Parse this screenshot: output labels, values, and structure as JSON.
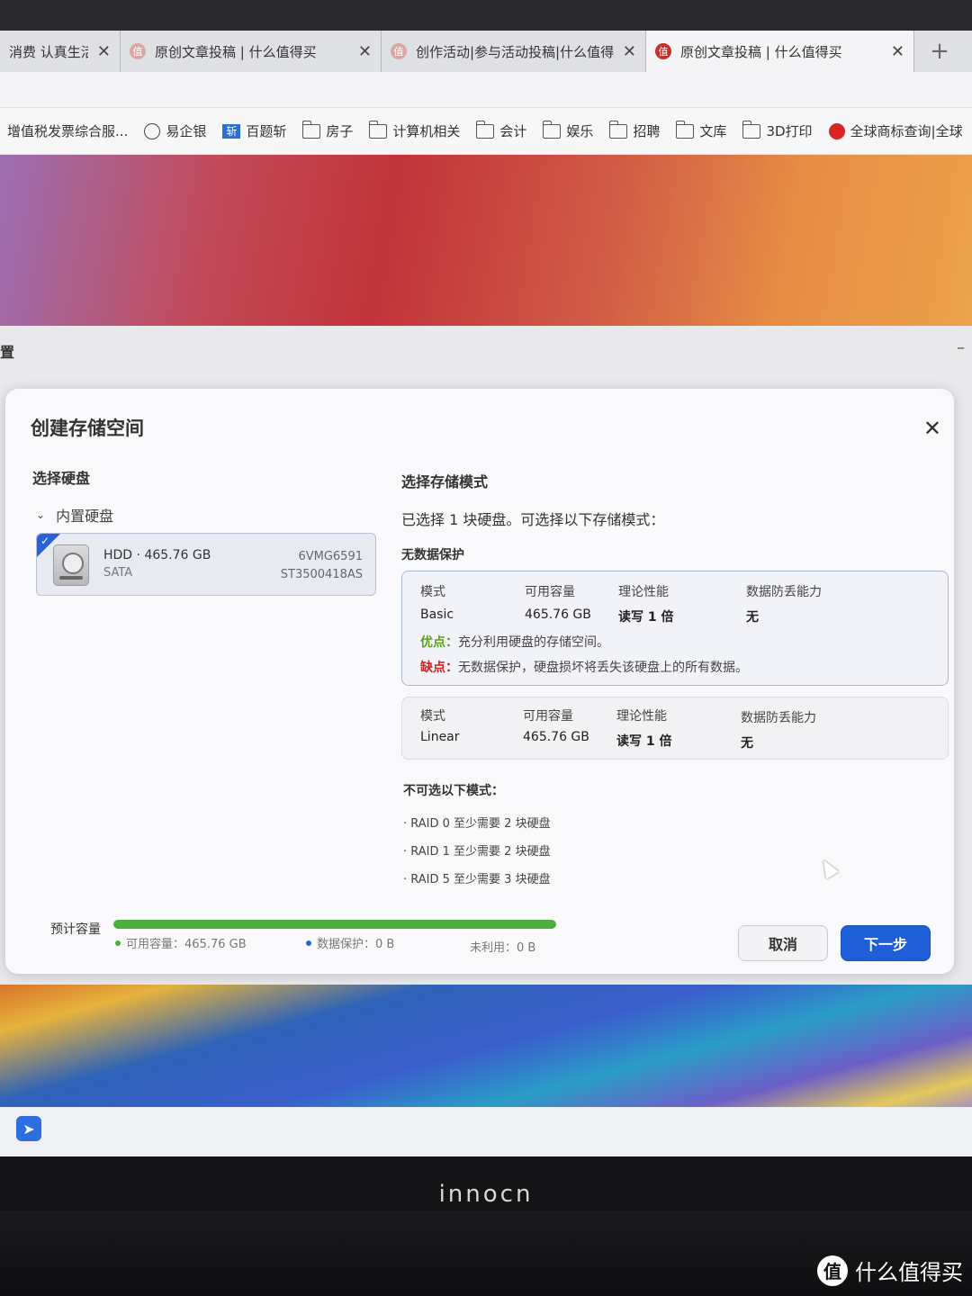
{
  "browser": {
    "tabs": [
      {
        "title": "消费 认真生活",
        "active": false
      },
      {
        "title": "原创文章投稿 | 什么值得买",
        "active": false
      },
      {
        "title": "创作活动|参与活动投稿|什么值得",
        "active": false
      },
      {
        "title": "原创文章投稿 | 什么值得买",
        "active": true
      }
    ],
    "new_tab": "+",
    "bookmarks": [
      {
        "label": "增值税发票综合服...",
        "icon": "none"
      },
      {
        "label": "易企银",
        "icon": "globe-icon"
      },
      {
        "label": "百题斩",
        "icon": "app-icon",
        "icon_text": "斩"
      },
      {
        "label": "房子",
        "icon": "folder-icon"
      },
      {
        "label": "计算机相关",
        "icon": "folder-icon"
      },
      {
        "label": "会计",
        "icon": "folder-icon"
      },
      {
        "label": "娱乐",
        "icon": "folder-icon"
      },
      {
        "label": "招聘",
        "icon": "folder-icon"
      },
      {
        "label": "文库",
        "icon": "folder-icon"
      },
      {
        "label": "3D打印",
        "icon": "folder-icon"
      },
      {
        "label": "全球商标查询|全球",
        "icon": "brand-icon"
      }
    ]
  },
  "app": {
    "title": "置",
    "minimize": "–"
  },
  "dialog": {
    "title": "创建存储空间",
    "close": "✕",
    "select_disk_title": "选择硬盘",
    "group_label": "内置硬盘",
    "disk": {
      "name": "HDD · 465.76 GB",
      "bus": "SATA",
      "serial": "6VMG6591",
      "model": "ST3500418AS",
      "checked": true
    },
    "mode_title": "选择存储模式",
    "selected_note": "已选择 1 块硬盘。可选择以下存储模式：",
    "no_protection_title": "无数据保护",
    "headers": {
      "mode": "模式",
      "capacity": "可用容量",
      "performance": "理论性能",
      "protection": "数据防丢能力"
    },
    "modes": [
      {
        "mode": "Basic",
        "capacity": "465.76 GB",
        "performance": "读写 1 倍",
        "protection": "无",
        "pro_label": "优点：",
        "pro_text": "充分利用硬盘的存储空间。",
        "con_label": "缺点：",
        "con_text": "无数据保护，硬盘损坏将丢失该硬盘上的所有数据。"
      },
      {
        "mode": "Linear",
        "capacity": "465.76 GB",
        "performance": "读写 1 倍",
        "protection": "无"
      }
    ],
    "unavailable_title": "不可选以下模式：",
    "unavailable": [
      "· RAID 0   至少需要 2 块硬盘",
      "· RAID 1   至少需要 2 块硬盘",
      "· RAID 5   至少需要 3 块硬盘"
    ],
    "capacity": {
      "label": "预计容量",
      "available": "可用容量：465.76 GB",
      "protection": "数据保护：0 B",
      "unused": "未利用：0 B",
      "fill_fraction": 1.0,
      "colors": {
        "available": "#4cae3d",
        "protection": "#2a62d8"
      }
    },
    "buttons": {
      "cancel": "取消",
      "next": "下一步"
    }
  },
  "monitor": {
    "brand": "innocn"
  },
  "watermark": {
    "text": "什么值得买",
    "logo": "值"
  }
}
